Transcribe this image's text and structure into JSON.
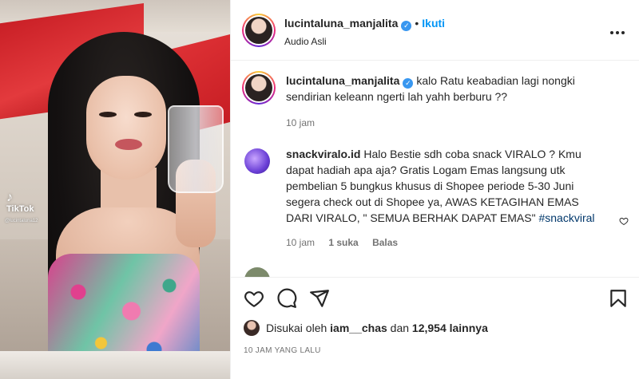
{
  "post": {
    "username": "lucintaluna_manjalita",
    "follow_label": "Ikuti",
    "separator": "•",
    "audio": "Audio Asli",
    "more_label": "•••"
  },
  "photo": {
    "watermark_brand": "TikTok",
    "watermark_handle": "@lucintaluna12"
  },
  "comments": [
    {
      "username": "lucintaluna_manjalita",
      "verified": true,
      "text": "kalo Ratu keabadian lagi nongki sendirian keleann ngerti lah yahh berburu ??",
      "time": "10 jam"
    },
    {
      "username": "snackviralo.id",
      "verified": false,
      "text": "Halo Bestie sdh coba snack VIRALO ? Kmu dapat hadiah apa aja? Gratis Logam Emas langsung utk pembelian 5 bungkus khusus di Shopee periode 5-30 Juni segera check out di Shopee ya, AWAS KETAGIHAN EMAS DARI VIRALO, \" SEMUA BERHAK DAPAT EMAS\"",
      "hashtag": "#snackviral",
      "time": "10 jam",
      "likes": "1 suka",
      "reply": "Balas"
    }
  ],
  "likes": {
    "prefix": "Disukai oleh",
    "user": "iam__chas",
    "joiner": "dan",
    "count": "12,954 lainnya"
  },
  "timestamp": "10 JAM YANG LALU",
  "icons": {
    "like": "heart-icon",
    "comment": "comment-icon",
    "share": "share-icon",
    "save": "bookmark-icon"
  },
  "colors": {
    "accent": "#0095f6",
    "verified": "#3897f0",
    "hashtag": "#00376b",
    "muted": "#737373"
  }
}
